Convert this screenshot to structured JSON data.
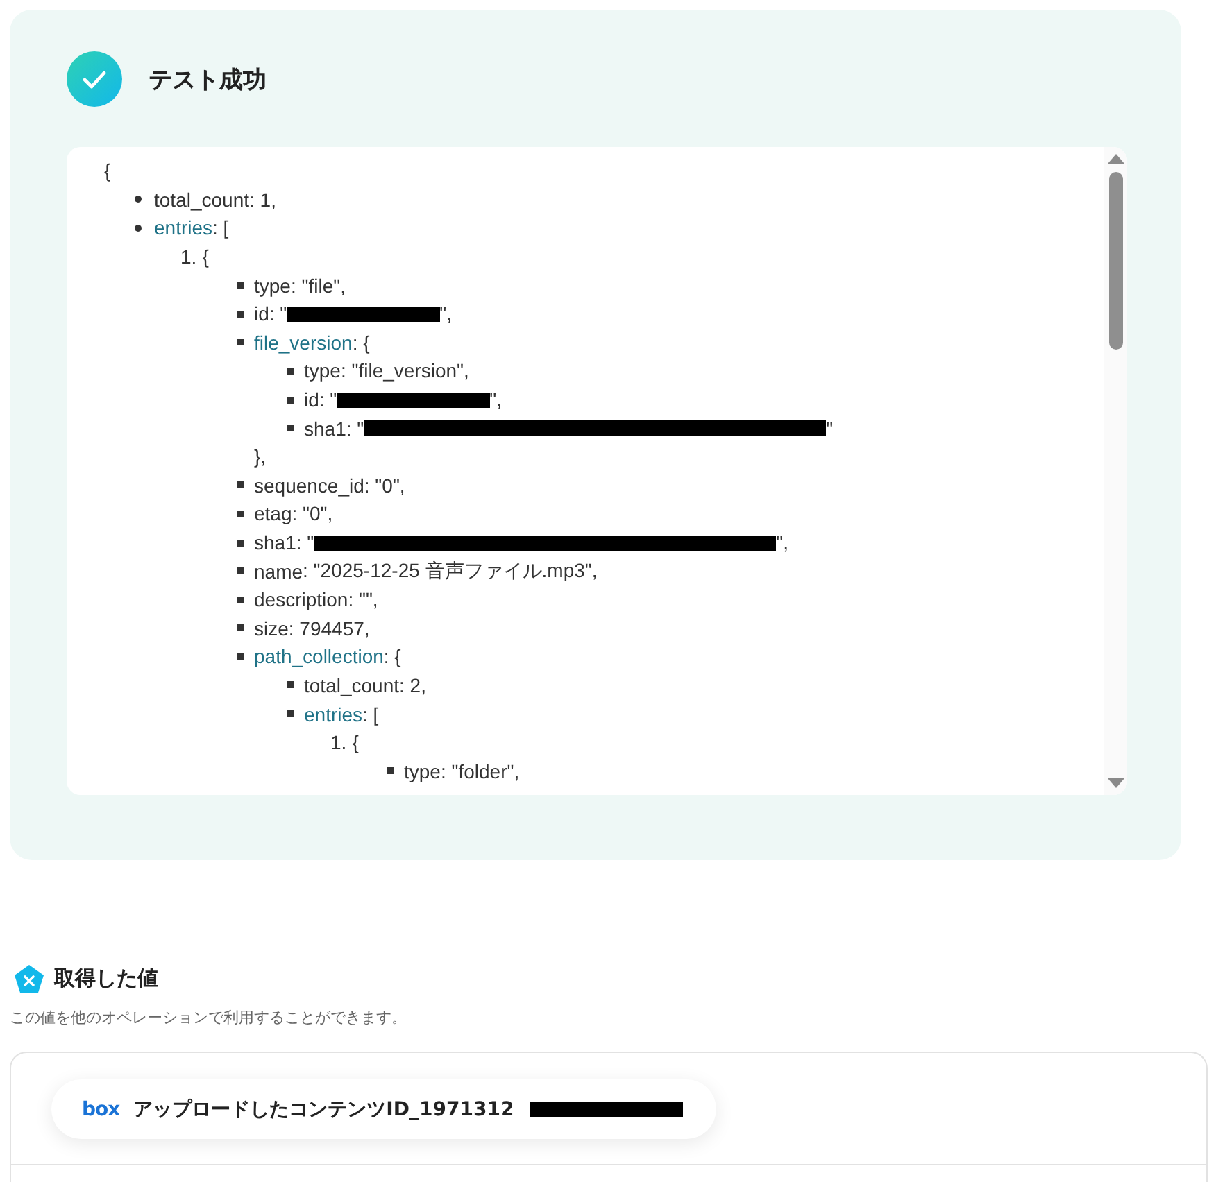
{
  "result": {
    "title": "テスト成功",
    "success": true,
    "json_tree": {
      "text": "{",
      "children": [
        {
          "kind": "disc",
          "key": "total_count",
          "link": false,
          "text": ": 1,"
        },
        {
          "kind": "disc",
          "key": "entries",
          "link": true,
          "text": ": [",
          "children": [
            {
              "kind": "ordered",
              "number": "1.",
              "text": "{",
              "children": [
                {
                  "kind": "square",
                  "key": "type",
                  "link": false,
                  "text": ": \"file\","
                },
                {
                  "kind": "square",
                  "key": "id",
                  "link": false,
                  "text": ": \"",
                  "redacted": true,
                  "wide": false,
                  "after": "\","
                },
                {
                  "kind": "square",
                  "key": "file_version",
                  "link": true,
                  "text": ": {",
                  "close": "},",
                  "children": [
                    {
                      "kind": "square",
                      "key": "type",
                      "link": false,
                      "text": ": \"file_version\","
                    },
                    {
                      "kind": "square",
                      "key": "id",
                      "link": false,
                      "text": ": \"",
                      "redacted": true,
                      "wide": false,
                      "after": "\","
                    },
                    {
                      "kind": "square",
                      "key": "sha1",
                      "link": false,
                      "text": ": \"",
                      "redacted": true,
                      "wide": true,
                      "after": "\""
                    }
                  ]
                },
                {
                  "kind": "square",
                  "key": "sequence_id",
                  "link": false,
                  "text": ": \"0\","
                },
                {
                  "kind": "square",
                  "key": "etag",
                  "link": false,
                  "text": ": \"0\","
                },
                {
                  "kind": "square",
                  "key": "sha1",
                  "link": false,
                  "text": ": \"",
                  "redacted": true,
                  "wide": true,
                  "after": "\","
                },
                {
                  "kind": "square",
                  "key": "name",
                  "link": false,
                  "text": ": \"2025-12-25 音声ファイル.mp3\","
                },
                {
                  "kind": "square",
                  "key": "description",
                  "link": false,
                  "text": ": \"\","
                },
                {
                  "kind": "square",
                  "key": "size",
                  "link": false,
                  "text": ": 794457,"
                },
                {
                  "kind": "square",
                  "key": "path_collection",
                  "link": true,
                  "text": ": {",
                  "children": [
                    {
                      "kind": "square",
                      "key": "total_count",
                      "link": false,
                      "text": ": 2,"
                    },
                    {
                      "kind": "square",
                      "key": "entries",
                      "link": true,
                      "text": ": [",
                      "children": [
                        {
                          "kind": "ordered",
                          "number": "1.",
                          "text": "{",
                          "children": [
                            {
                              "kind": "square",
                              "key": "type",
                              "link": false,
                              "text": ": \"folder\","
                            }
                          ]
                        }
                      ]
                    }
                  ]
                }
              ]
            }
          ]
        }
      ]
    }
  },
  "values": {
    "title": "取得した値",
    "description": "この値を他のオペレーションで利用することができます。",
    "items": [
      {
        "logo": "box",
        "label": "アップロードしたコンテンツID_1971312",
        "redacted": true
      }
    ]
  }
}
